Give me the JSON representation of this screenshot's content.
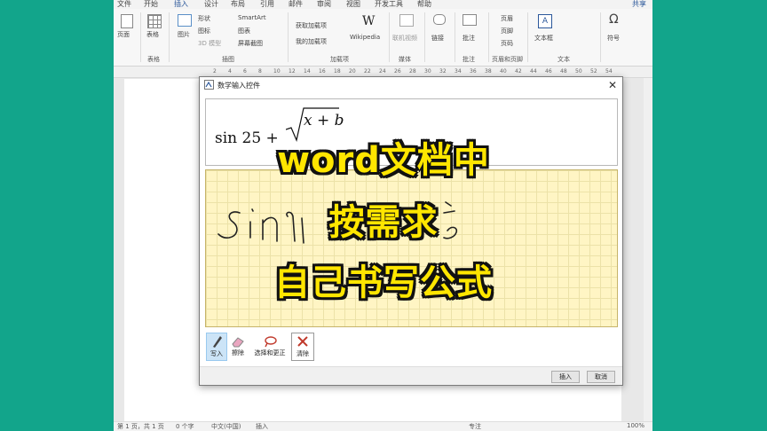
{
  "menu": {
    "file": "文件",
    "home": "开始",
    "insert": "插入",
    "design": "设计",
    "layout": "布局",
    "references": "引用",
    "mailings": "邮件",
    "review": "审阅",
    "view": "视图",
    "developer": "开发工具",
    "help": "帮助",
    "share": "共享"
  },
  "ribbon": {
    "page": "页面",
    "table": "表格",
    "picture": "图片",
    "shapes": "形状",
    "icons": "图标",
    "models3d": "3D 模型",
    "smartart": "SmartArt",
    "chart": "图表",
    "screenshot": "屏幕截图",
    "get_addins": "获取加载项",
    "my_addins": "我的加载项",
    "wikipedia": "Wikipedia",
    "online_video": "联机视频",
    "link": "链接",
    "comment": "批注",
    "header": "页眉",
    "footer": "页脚",
    "page_number": "页码",
    "textbox": "文本框",
    "symbol": "符号",
    "groups": {
      "tables": "表格",
      "illustrations": "插图",
      "addins": "加载项",
      "media": "媒体",
      "comments": "批注",
      "header_footer": "页眉和页脚",
      "text": "文本"
    }
  },
  "ruler_ticks": [
    "2",
    "4",
    "6",
    "8",
    "10",
    "12",
    "14",
    "16",
    "18",
    "20",
    "22",
    "24",
    "26",
    "28",
    "30",
    "32",
    "34",
    "36",
    "38",
    "40",
    "42",
    "44",
    "46",
    "48",
    "50",
    "52",
    "54"
  ],
  "dialog": {
    "title": "数学输入控件",
    "preview": {
      "prefix": "sin 25 +",
      "radicand": "x + b"
    },
    "tools": [
      {
        "label": "写入",
        "icon": "pen-icon"
      },
      {
        "label": "擦除",
        "icon": "eraser-icon"
      },
      {
        "label": "选择和更正",
        "icon": "lasso-icon"
      },
      {
        "label": "清除",
        "icon": "clear-icon"
      }
    ],
    "insert_button": "插入",
    "cancel_button": "取消"
  },
  "statusbar": {
    "page": "第 1 页，共 1 页",
    "words": "0 个字",
    "language": "中文(中国)",
    "mode": "插入",
    "focus": "专注",
    "zoom": "100%"
  },
  "caption": {
    "line1": "word文档中",
    "line2": "按需求",
    "line3": "自己书写公式"
  },
  "colors": {
    "background": "#12a58b",
    "caption_fill": "#ffe600",
    "caption_outline": "#111111",
    "pad": "#fff5c4",
    "accent": "#2b579a"
  }
}
